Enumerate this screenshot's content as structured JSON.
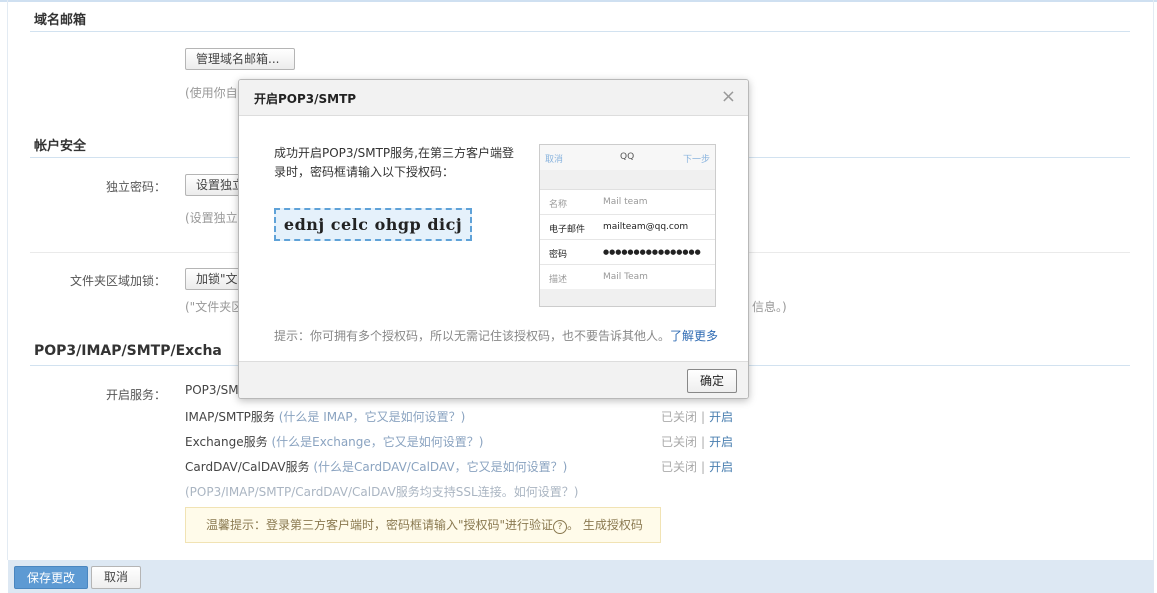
{
  "sections": {
    "domain_mail": {
      "title": "域名邮箱",
      "manage_button": "管理域名邮箱...",
      "hint": "(使用你自"
    },
    "account_security": {
      "title": "帐户安全",
      "password_label": "独立密码：",
      "password_button": "设置独立",
      "password_hint": "(设置独立",
      "folder_label": "文件夹区域加锁：",
      "folder_button": "加锁\"文",
      "folder_hint_start": "(\"文件夹区",
      "folder_hint_end": "信息。)"
    },
    "pop3": {
      "title": "POP3/IMAP/SMTP/Excha",
      "service_label": "开启服务：",
      "rows": [
        {
          "name": "POP3/SM",
          "help": "",
          "status": "",
          "action": ""
        },
        {
          "name": "IMAP/SMTP服务",
          "help": "(什么是 IMAP，它又是如何设置？)",
          "status": "已关闭",
          "action": "开启"
        },
        {
          "name": "Exchange服务",
          "help": "(什么是Exchange，它又是如何设置？)",
          "status": "已关闭",
          "action": "开启"
        },
        {
          "name": "CardDAV/CalDAV服务",
          "help": "(什么是CardDAV/CalDAV，它又是如何设置？)",
          "status": "已关闭",
          "action": "开启"
        }
      ],
      "ssl_note": "(POP3/IMAP/SMTP/CardDAV/CalDAV服务均支持SSL连接。如何设置？)",
      "warm_tip": "温馨提示：登录第三方客户端时，密码框请输入\"授权码\"进行验证",
      "warm_circled": "?",
      "warm_sep": "。",
      "warm_link": "生成授权码"
    }
  },
  "footer": {
    "save": "保存更改",
    "cancel": "取消"
  },
  "dialog": {
    "title": "开启POP3/SMTP",
    "close": "×",
    "message": "成功开启POP3/SMTP服务,在第三方客户端登录时，密码框请输入以下授权码：",
    "auth_code": "ednj celc ohgp dicj",
    "phone": {
      "nav_left": "取消",
      "nav_center": "QQ",
      "nav_right": "下一步",
      "rows": [
        {
          "key": "名称",
          "value": "Mail team"
        },
        {
          "key": "电子邮件",
          "value": "mailteam@qq.com"
        },
        {
          "key": "密码",
          "value": "●●●●●●●●●●●●●●●●"
        },
        {
          "key": "描述",
          "value": "Mail Team"
        }
      ]
    },
    "tip": "提示：你可拥有多个授权码，所以无需记住该授权码，也不要告诉其他人。",
    "tip_link": "了解更多",
    "ok": "确定"
  }
}
